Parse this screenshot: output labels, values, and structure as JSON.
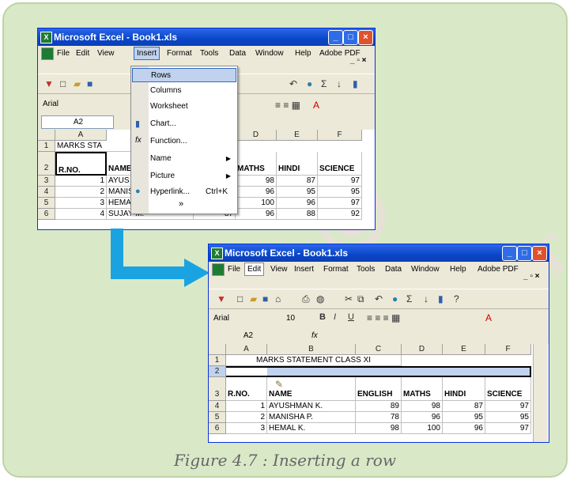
{
  "caption": "Figure 4.7 : Inserting a row",
  "watermark": [
    "NCERT",
    "© NCERT",
    "not to be republished"
  ],
  "window1": {
    "title": "Microsoft Excel - Book1.xls",
    "menus": [
      "File",
      "Edit",
      "View",
      "Insert",
      "Format",
      "Tools",
      "Data",
      "Window",
      "Help",
      "Adobe PDF"
    ],
    "font": "Arial",
    "namebox": "A2",
    "columns": [
      "A",
      "D",
      "E",
      "F"
    ],
    "rows": [
      "1",
      "2",
      "3",
      "4",
      "5",
      "6"
    ],
    "r1": "MARKS STA",
    "r2": [
      "R.NO.",
      "NAME",
      "MATHS",
      "HINDI",
      "SCIENCE"
    ],
    "data": [
      [
        "1",
        "AYUS",
        "98",
        "87",
        "97"
      ],
      [
        "2",
        "MANIS",
        "96",
        "95",
        "95"
      ],
      [
        "3",
        "HEMA",
        "100",
        "96",
        "97"
      ],
      [
        "4",
        "SUJAY M.",
        "87",
        "96",
        "88",
        "92"
      ]
    ],
    "insert_menu": [
      {
        "label": "Rows"
      },
      {
        "label": "Columns"
      },
      {
        "label": "Worksheet"
      },
      {
        "label": "Chart..."
      },
      {
        "label": "Function..."
      },
      {
        "label": "Name"
      },
      {
        "label": "Picture"
      },
      {
        "label": "Hyperlink...",
        "shortcut": "Ctrl+K"
      }
    ],
    "more_glyph": "»"
  },
  "window2": {
    "title": "Microsoft Excel - Book1.xls",
    "menus": [
      "File",
      "Edit",
      "View",
      "Insert",
      "Format",
      "Tools",
      "Data",
      "Window",
      "Help",
      "Adobe PDF"
    ],
    "font": "Arial",
    "font_size": "10",
    "format_buttons": [
      "B",
      "I",
      "U"
    ],
    "namebox": "A2",
    "fx": "fx",
    "columns": [
      "A",
      "B",
      "C",
      "D",
      "E",
      "F"
    ],
    "rows": [
      "1",
      "2",
      "3",
      "4",
      "5",
      "6"
    ],
    "r1": "MARKS STATEMENT CLASS XI",
    "headers": [
      "R.NO.",
      "NAME",
      "ENGLISH",
      "MATHS",
      "HINDI",
      "SCIENCE"
    ],
    "data": [
      [
        "1",
        "AYUSHMAN K.",
        "89",
        "98",
        "87",
        "97"
      ],
      [
        "2",
        "MANISHA P.",
        "78",
        "96",
        "95",
        "95"
      ],
      [
        "3",
        "HEMAL K.",
        "98",
        "100",
        "96",
        "97"
      ]
    ]
  },
  "colors": {
    "arrow": "#1aa3e0",
    "card": "#d9e9c8",
    "title": "#0a46c8",
    "selection": "#c1d2ee"
  }
}
